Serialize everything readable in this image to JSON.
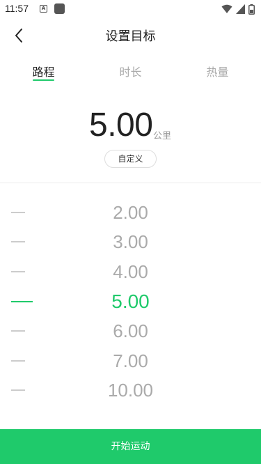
{
  "status_bar": {
    "time": "11:57",
    "a_icon_glyph": "A",
    "icons": [
      "wifi-icon",
      "signal-icon",
      "battery-icon"
    ]
  },
  "nav": {
    "back_icon": "chevron-left-icon",
    "title": "设置目标"
  },
  "tabs": [
    {
      "label": "路程",
      "active": true
    },
    {
      "label": "时长",
      "active": false
    },
    {
      "label": "热量",
      "active": false
    }
  ],
  "goal": {
    "value": "5.00",
    "unit": "公里",
    "custom_label": "自定义"
  },
  "picker": {
    "options": [
      "2.00",
      "3.00",
      "4.00",
      "5.00",
      "6.00",
      "7.00",
      "10.00"
    ],
    "selected": "5.00"
  },
  "start_button_label": "开始运动",
  "colors": {
    "accent": "#1fca6b",
    "text_primary": "#222222",
    "text_muted": "#aaaaaa"
  }
}
